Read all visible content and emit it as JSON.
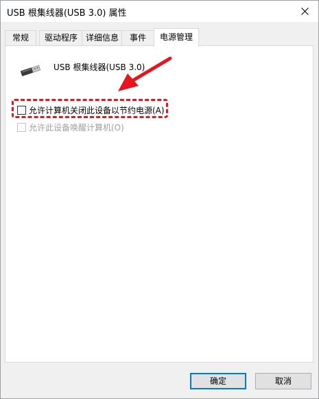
{
  "window": {
    "title": "USB 根集线器(USB 3.0) 属性"
  },
  "tabs": [
    {
      "label": "常规"
    },
    {
      "label": "驱动程序"
    },
    {
      "label": "详细信息"
    },
    {
      "label": "事件"
    },
    {
      "label": "电源管理"
    }
  ],
  "active_tab": "电源管理",
  "device": {
    "name": "USB 根集线器(USB 3.0)",
    "icon": "usb-plug-icon"
  },
  "options": [
    {
      "label": "允许计算机关闭此设备以节约电源(A)",
      "checked": false,
      "enabled": true
    },
    {
      "label": "允许此设备唤醒计算机(O)",
      "checked": false,
      "enabled": false
    }
  ],
  "buttons": {
    "ok": "确定",
    "cancel": "取消"
  },
  "colors": {
    "highlight": "#e5161e",
    "focus_border": "#0078d7"
  }
}
